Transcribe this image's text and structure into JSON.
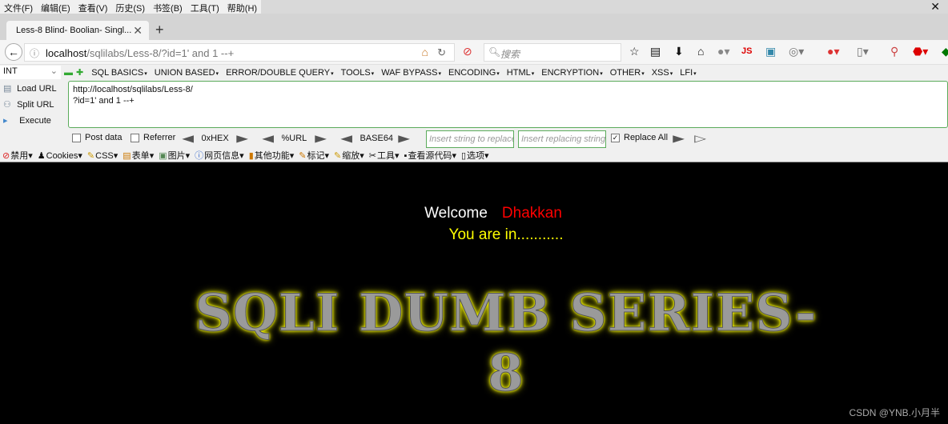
{
  "menu": [
    "文件(F)",
    "编辑(E)",
    "查看(V)",
    "历史(S)",
    "书签(B)",
    "工具(T)",
    "帮助(H)"
  ],
  "tab": {
    "title": "Less-8 Blind- Boolian- Singl..."
  },
  "address": {
    "host": "localhost",
    "path": "/sqlilabs/Less-8/?id=1' and 1 --+"
  },
  "search": {
    "placeholder": "搜索"
  },
  "hackbar": {
    "select": "INT",
    "menus": [
      "SQL BASICS",
      "UNION BASED",
      "ERROR/DOUBLE QUERY",
      "TOOLS",
      "WAF BYPASS",
      "ENCODING",
      "HTML",
      "ENCRYPTION",
      "OTHER",
      "XSS",
      "LFI"
    ],
    "load": "Load URL",
    "split": "Split URL",
    "execute": "Execute",
    "url_text": "http://localhost/sqlilabs/Less-8/\n?id=1' and 1 --+",
    "post": "Post data",
    "referrer": "Referrer",
    "hex": "0xHEX",
    "urlenc": "%URL",
    "b64": "BASE64",
    "replace_ph": "Insert string to replace",
    "replacing_ph": "Insert replacing string",
    "replace_all": "Replace All"
  },
  "cntools": [
    "禁用",
    "Cookies",
    "CSS",
    "表单",
    "图片",
    "网页信息",
    "其他功能",
    "标记",
    "缩放",
    "工具",
    "查看源代码",
    "选项"
  ],
  "page": {
    "welcome": "Welcome",
    "name": "Dhakkan",
    "status": "You are in...........",
    "logo": "SQLI DUMB SERIES-8"
  },
  "watermark": "CSDN @YNB.小月半",
  "colors": {
    "name": "#ff0000",
    "status": "#ffff00",
    "accent": "#5bab5b"
  }
}
